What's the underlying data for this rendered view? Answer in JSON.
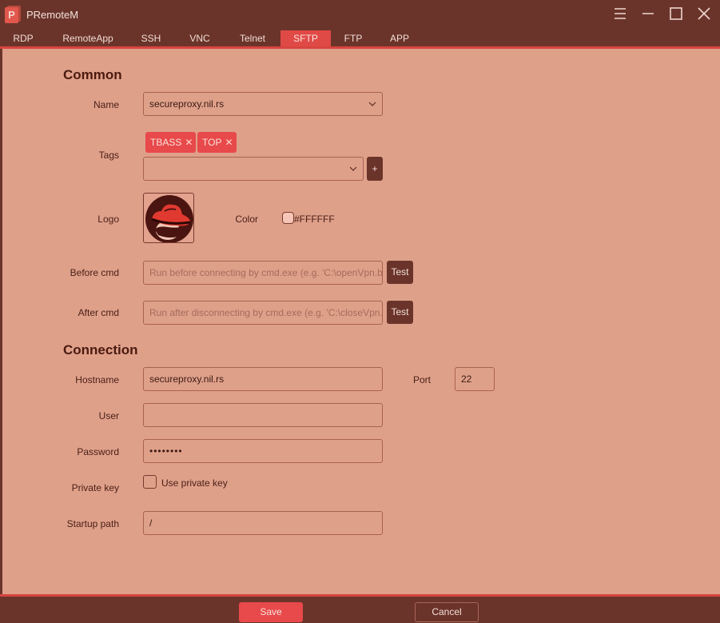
{
  "window": {
    "title": "PRemoteM",
    "logo_letter": "P",
    "icons": [
      "hamburger-menu-icon",
      "minimize-icon",
      "maximize-icon",
      "close-icon"
    ]
  },
  "tabs": [
    {
      "label": "RDP"
    },
    {
      "label": "RemoteApp"
    },
    {
      "label": "SSH"
    },
    {
      "label": "VNC"
    },
    {
      "label": "Telnet"
    },
    {
      "label": "SFTP",
      "active": true
    },
    {
      "label": "FTP"
    },
    {
      "label": "APP"
    }
  ],
  "common": {
    "title": "Common",
    "name_label": "Name",
    "name_value": "secureproxy.nil.rs",
    "tags_label": "Tags",
    "tags": [
      "TBASS",
      "TOP"
    ],
    "tag_input_value": "",
    "add_tag_label": "+",
    "logo_label": "Logo",
    "color_label": "Color",
    "color_value": "#FFFFFF",
    "before_cmd_label": "Before cmd",
    "before_cmd_placeholder": "Run before connecting by cmd.exe (e.g. 'C:\\openVpn.b",
    "after_cmd_label": "After cmd",
    "after_cmd_placeholder": "Run after disconnecting by cmd.exe (e.g. 'C:\\closeVpn.",
    "test_label": "Test"
  },
  "connection": {
    "title": "Connection",
    "hostname_label": "Hostname",
    "hostname_value": "secureproxy.nil.rs",
    "port_label": "Port",
    "port_value": "22",
    "user_label": "User",
    "user_value": "",
    "password_label": "Password",
    "password_value": "••••••••",
    "private_key_label": "Private key",
    "use_private_key_label": "Use private key",
    "use_private_key_checked": false,
    "startup_path_label": "Startup path",
    "startup_path_value": "/"
  },
  "footer": {
    "save_label": "Save",
    "cancel_label": "Cancel"
  },
  "colors": {
    "chrome": "#6b342a",
    "content_bg": "#dfa08a",
    "accent": "#e8494a"
  }
}
